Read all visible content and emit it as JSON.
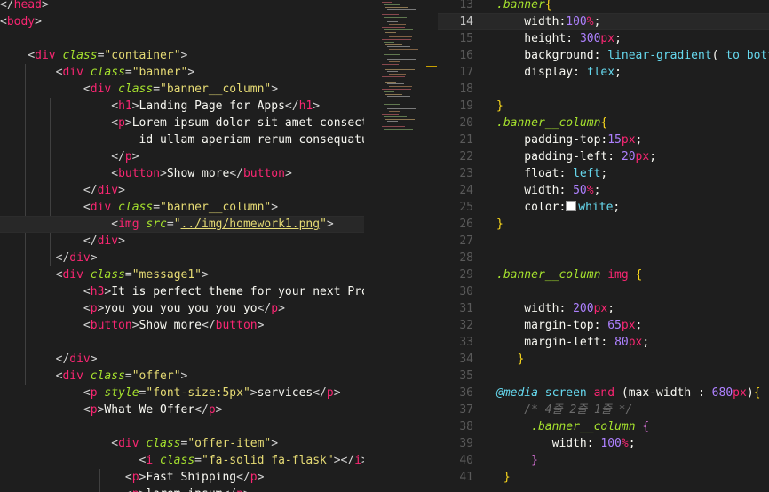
{
  "left_editor": {
    "lines": [
      [
        [
          "t-br",
          "</"
        ],
        [
          "t-tag",
          "head"
        ],
        [
          "t-br",
          ">"
        ]
      ],
      [
        [
          "t-br",
          "<"
        ],
        [
          "t-tag",
          "body"
        ],
        [
          "t-br",
          ">"
        ]
      ],
      [],
      [
        [
          "t-text",
          "    "
        ],
        [
          "t-br",
          "<"
        ],
        [
          "t-tag",
          "div"
        ],
        [
          "t-text",
          " "
        ],
        [
          "t-attr",
          "class"
        ],
        [
          "t-br",
          "="
        ],
        [
          "t-str",
          "\"container\""
        ],
        [
          "t-br",
          ">"
        ]
      ],
      [
        [
          "t-text",
          "        "
        ],
        [
          "t-br",
          "<"
        ],
        [
          "t-tag",
          "div"
        ],
        [
          "t-text",
          " "
        ],
        [
          "t-attr",
          "class"
        ],
        [
          "t-br",
          "="
        ],
        [
          "t-str",
          "\"banner\""
        ],
        [
          "t-br",
          ">"
        ]
      ],
      [
        [
          "t-text",
          "            "
        ],
        [
          "t-br",
          "<"
        ],
        [
          "t-tag",
          "div"
        ],
        [
          "t-text",
          " "
        ],
        [
          "t-attr",
          "class"
        ],
        [
          "t-br",
          "="
        ],
        [
          "t-str",
          "\"banner__column\""
        ],
        [
          "t-br",
          ">"
        ]
      ],
      [
        [
          "t-text",
          "                "
        ],
        [
          "t-br",
          "<"
        ],
        [
          "t-tag",
          "h1"
        ],
        [
          "t-br",
          ">"
        ],
        [
          "t-text",
          "Landing Page for Apps"
        ],
        [
          "t-br",
          "</"
        ],
        [
          "t-tag",
          "h1"
        ],
        [
          "t-br",
          ">"
        ]
      ],
      [
        [
          "t-text",
          "                "
        ],
        [
          "t-br",
          "<"
        ],
        [
          "t-tag",
          "p"
        ],
        [
          "t-br",
          ">"
        ],
        [
          "t-text",
          "Lorem ipsum dolor sit amet consectetur adipisicing elit."
        ]
      ],
      [
        [
          "t-text",
          "                    id ullam aperiam rerum consequatur reiciendis"
        ]
      ],
      [
        [
          "t-text",
          "                "
        ],
        [
          "t-br",
          "</"
        ],
        [
          "t-tag",
          "p"
        ],
        [
          "t-br",
          ">"
        ]
      ],
      [
        [
          "t-text",
          "                "
        ],
        [
          "t-br",
          "<"
        ],
        [
          "t-tag",
          "button"
        ],
        [
          "t-br",
          ">"
        ],
        [
          "t-text",
          "Show more"
        ],
        [
          "t-br",
          "</"
        ],
        [
          "t-tag",
          "button"
        ],
        [
          "t-br",
          ">"
        ]
      ],
      [
        [
          "t-text",
          "            "
        ],
        [
          "t-br",
          "</"
        ],
        [
          "t-tag",
          "div"
        ],
        [
          "t-br",
          ">"
        ]
      ],
      [
        [
          "t-text",
          "            "
        ],
        [
          "t-br",
          "<"
        ],
        [
          "t-tag",
          "div"
        ],
        [
          "t-text",
          " "
        ],
        [
          "t-attr",
          "class"
        ],
        [
          "t-br",
          "="
        ],
        [
          "t-str",
          "\"banner__column\""
        ],
        [
          "t-br",
          ">"
        ]
      ],
      [
        [
          "t-text",
          "                "
        ],
        [
          "t-br",
          "<"
        ],
        [
          "t-tag",
          "img"
        ],
        [
          "t-text",
          " "
        ],
        [
          "t-attr",
          "src"
        ],
        [
          "t-br",
          "="
        ],
        [
          "t-str",
          "\""
        ],
        [
          "t-link",
          "../img/homework1.png"
        ],
        [
          "t-str",
          "\""
        ],
        [
          "t-br",
          ">"
        ]
      ],
      [
        [
          "t-text",
          "            "
        ],
        [
          "t-br",
          "</"
        ],
        [
          "t-tag",
          "div"
        ],
        [
          "t-br",
          ">"
        ]
      ],
      [
        [
          "t-text",
          "        "
        ],
        [
          "t-br",
          "</"
        ],
        [
          "t-tag",
          "div"
        ],
        [
          "t-br",
          ">"
        ]
      ],
      [
        [
          "t-text",
          "        "
        ],
        [
          "t-br",
          "<"
        ],
        [
          "t-tag",
          "div"
        ],
        [
          "t-text",
          " "
        ],
        [
          "t-attr",
          "class"
        ],
        [
          "t-br",
          "="
        ],
        [
          "t-str",
          "\"message1\""
        ],
        [
          "t-br",
          ">"
        ]
      ],
      [
        [
          "t-text",
          "            "
        ],
        [
          "t-br",
          "<"
        ],
        [
          "t-tag",
          "h3"
        ],
        [
          "t-br",
          ">"
        ],
        [
          "t-text",
          "It is perfect theme for your next Project"
        ],
        [
          "t-br",
          "</"
        ],
        [
          "t-tag",
          "h3"
        ],
        [
          "t-br",
          ">"
        ]
      ],
      [
        [
          "t-text",
          "            "
        ],
        [
          "t-br",
          "<"
        ],
        [
          "t-tag",
          "p"
        ],
        [
          "t-br",
          ">"
        ],
        [
          "t-text",
          "you you you you you yo"
        ],
        [
          "t-br",
          "</"
        ],
        [
          "t-tag",
          "p"
        ],
        [
          "t-br",
          ">"
        ]
      ],
      [
        [
          "t-text",
          "            "
        ],
        [
          "t-br",
          "<"
        ],
        [
          "t-tag",
          "button"
        ],
        [
          "t-br",
          ">"
        ],
        [
          "t-text",
          "Show more"
        ],
        [
          "t-br",
          "</"
        ],
        [
          "t-tag",
          "button"
        ],
        [
          "t-br",
          ">"
        ]
      ],
      [],
      [
        [
          "t-text",
          "        "
        ],
        [
          "t-br",
          "</"
        ],
        [
          "t-tag",
          "div"
        ],
        [
          "t-br",
          ">"
        ]
      ],
      [
        [
          "t-text",
          "        "
        ],
        [
          "t-br",
          "<"
        ],
        [
          "t-tag",
          "div"
        ],
        [
          "t-text",
          " "
        ],
        [
          "t-attr",
          "class"
        ],
        [
          "t-br",
          "="
        ],
        [
          "t-str",
          "\"offer\""
        ],
        [
          "t-br",
          ">"
        ]
      ],
      [
        [
          "t-text",
          "            "
        ],
        [
          "t-br",
          "<"
        ],
        [
          "t-tag",
          "p"
        ],
        [
          "t-text",
          " "
        ],
        [
          "t-attr",
          "style"
        ],
        [
          "t-br",
          "="
        ],
        [
          "t-str",
          "\"font-size:5px\""
        ],
        [
          "t-br",
          ">"
        ],
        [
          "t-text",
          "services"
        ],
        [
          "t-br",
          "</"
        ],
        [
          "t-tag",
          "p"
        ],
        [
          "t-br",
          ">"
        ]
      ],
      [
        [
          "t-text",
          "            "
        ],
        [
          "t-br",
          "<"
        ],
        [
          "t-tag",
          "p"
        ],
        [
          "t-br",
          ">"
        ],
        [
          "t-text",
          "What We Offer"
        ],
        [
          "t-br",
          "</"
        ],
        [
          "t-tag",
          "p"
        ],
        [
          "t-br",
          ">"
        ]
      ],
      [],
      [
        [
          "t-text",
          "                "
        ],
        [
          "t-br",
          "<"
        ],
        [
          "t-tag",
          "div"
        ],
        [
          "t-text",
          " "
        ],
        [
          "t-attr",
          "class"
        ],
        [
          "t-br",
          "="
        ],
        [
          "t-str",
          "\"offer-item\""
        ],
        [
          "t-br",
          ">"
        ]
      ],
      [
        [
          "t-text",
          "                    "
        ],
        [
          "t-br",
          "<"
        ],
        [
          "t-tag",
          "i"
        ],
        [
          "t-text",
          " "
        ],
        [
          "t-attr",
          "class"
        ],
        [
          "t-br",
          "="
        ],
        [
          "t-str",
          "\"fa-solid fa-flask\""
        ],
        [
          "t-br",
          ">"
        ],
        [
          "t-br",
          "</"
        ],
        [
          "t-tag",
          "i"
        ],
        [
          "t-br",
          ">"
        ]
      ],
      [
        [
          "t-text",
          "                  "
        ],
        [
          "t-br",
          "<"
        ],
        [
          "t-tag",
          "p"
        ],
        [
          "t-br",
          ">"
        ],
        [
          "t-text",
          "Fast Shipping"
        ],
        [
          "t-br",
          "</"
        ],
        [
          "t-tag",
          "p"
        ],
        [
          "t-br",
          ">"
        ]
      ],
      [
        [
          "t-text",
          "                  "
        ],
        [
          "t-br",
          "<"
        ],
        [
          "t-tag",
          "p"
        ],
        [
          "t-br",
          ">"
        ],
        [
          "t-text",
          "lorem ipsum"
        ],
        [
          "t-br",
          "</"
        ],
        [
          "t-tag",
          "p"
        ],
        [
          "t-br",
          ">"
        ]
      ]
    ],
    "highlight_line": 13
  },
  "right_editor": {
    "first_line_number": 13,
    "active_line_number": 14,
    "lines": [
      [
        [
          "t-sel",
          ".banner"
        ],
        [
          "t-brace",
          "{"
        ]
      ],
      [
        [
          "t-prop",
          "    width"
        ],
        [
          "t-punc",
          ":"
        ],
        [
          "t-num",
          "100"
        ],
        [
          "t-unit",
          "%"
        ],
        [
          "t-punc",
          ";"
        ]
      ],
      [
        [
          "t-prop",
          "    height"
        ],
        [
          "t-punc",
          ": "
        ],
        [
          "t-num",
          "300"
        ],
        [
          "t-unit",
          "px"
        ],
        [
          "t-punc",
          ";"
        ]
      ],
      [
        [
          "t-prop",
          "    background"
        ],
        [
          "t-punc",
          ": "
        ],
        [
          "t-fn",
          "linear-gradient"
        ],
        [
          "t-punc",
          "( "
        ],
        [
          "t-kw",
          "to bottom"
        ],
        [
          "t-punc",
          ", "
        ],
        [
          "t-kw",
          "#"
        ]
      ],
      [
        [
          "t-prop",
          "    display"
        ],
        [
          "t-punc",
          ": "
        ],
        [
          "t-kw",
          "flex"
        ],
        [
          "t-punc",
          ";"
        ]
      ],
      [],
      [
        [
          "t-brace",
          "}"
        ]
      ],
      [
        [
          "t-sel",
          ".banner__column"
        ],
        [
          "t-brace",
          "{"
        ]
      ],
      [
        [
          "t-prop",
          "    padding-top"
        ],
        [
          "t-punc",
          ":"
        ],
        [
          "t-num",
          "15"
        ],
        [
          "t-unit",
          "px"
        ],
        [
          "t-punc",
          ";"
        ]
      ],
      [
        [
          "t-prop",
          "    padding-left"
        ],
        [
          "t-punc",
          ": "
        ],
        [
          "t-num",
          "20"
        ],
        [
          "t-unit",
          "px"
        ],
        [
          "t-punc",
          ";"
        ]
      ],
      [
        [
          "t-prop",
          "    float"
        ],
        [
          "t-punc",
          ": "
        ],
        [
          "t-kw",
          "left"
        ],
        [
          "t-punc",
          ";"
        ]
      ],
      [
        [
          "t-prop",
          "    width"
        ],
        [
          "t-punc",
          ": "
        ],
        [
          "t-num",
          "50"
        ],
        [
          "t-unit",
          "%"
        ],
        [
          "t-punc",
          ";"
        ]
      ],
      [
        [
          "t-prop",
          "    color"
        ],
        [
          "t-punc",
          ":"
        ],
        [
          "swatch",
          ""
        ],
        [
          "t-kw",
          "white"
        ],
        [
          "t-punc",
          ";"
        ]
      ],
      [
        [
          "t-brace",
          "}"
        ]
      ],
      [],
      [],
      [
        [
          "t-sel",
          ".banner__column"
        ],
        [
          "t-punc",
          " "
        ],
        [
          "t-tag",
          "img"
        ],
        [
          "t-punc",
          " "
        ],
        [
          "t-brace",
          "{"
        ]
      ],
      [],
      [
        [
          "t-prop",
          "    width"
        ],
        [
          "t-punc",
          ": "
        ],
        [
          "t-num",
          "200"
        ],
        [
          "t-unit",
          "px"
        ],
        [
          "t-punc",
          ";"
        ]
      ],
      [
        [
          "t-prop",
          "    margin-top"
        ],
        [
          "t-punc",
          ": "
        ],
        [
          "t-num",
          "65"
        ],
        [
          "t-unit",
          "px"
        ],
        [
          "t-punc",
          ";"
        ]
      ],
      [
        [
          "t-prop",
          "    margin-left"
        ],
        [
          "t-punc",
          ": "
        ],
        [
          "t-num",
          "80"
        ],
        [
          "t-unit",
          "px"
        ],
        [
          "t-punc",
          ";"
        ]
      ],
      [
        [
          "t-punc",
          "   "
        ],
        [
          "t-brace",
          "}"
        ]
      ],
      [],
      [
        [
          "t-atrule",
          "@media"
        ],
        [
          "t-punc",
          " "
        ],
        [
          "t-kw",
          "screen"
        ],
        [
          "t-punc",
          " "
        ],
        [
          "t-kwp",
          "and"
        ],
        [
          "t-punc",
          " ("
        ],
        [
          "t-prop",
          "max-width"
        ],
        [
          "t-punc",
          " : "
        ],
        [
          "t-num",
          "680"
        ],
        [
          "t-unit",
          "px"
        ],
        [
          "t-punc",
          ")"
        ],
        [
          "t-brace",
          "{"
        ]
      ],
      [
        [
          "t-com",
          "    /* 4줄 2줄 1줄 */"
        ]
      ],
      [
        [
          "t-punc",
          "     "
        ],
        [
          "t-sel",
          ".banner__column"
        ],
        [
          "t-punc",
          " "
        ],
        [
          "t-brace2",
          "{"
        ]
      ],
      [
        [
          "t-prop",
          "        width"
        ],
        [
          "t-punc",
          ": "
        ],
        [
          "t-num",
          "100"
        ],
        [
          "t-unit",
          "%"
        ],
        [
          "t-punc",
          ";"
        ]
      ],
      [
        [
          "t-punc",
          "     "
        ],
        [
          "t-brace2",
          "}"
        ]
      ],
      [
        [
          "t-punc",
          " "
        ],
        [
          "t-brace",
          "}"
        ]
      ]
    ]
  }
}
